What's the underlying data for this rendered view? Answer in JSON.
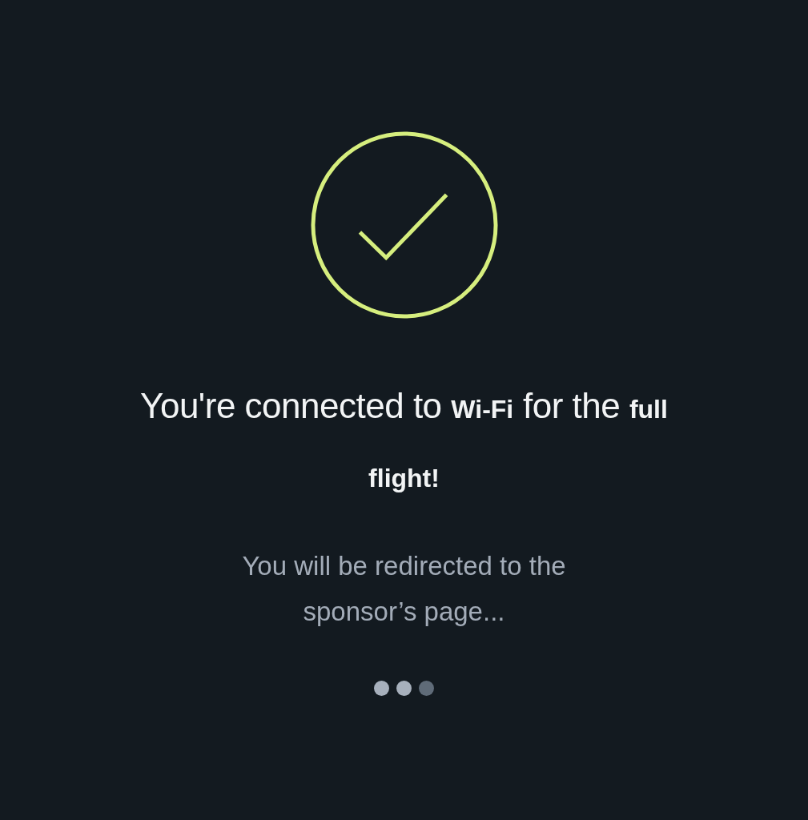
{
  "status_icon": {
    "kind": "check"
  },
  "headline": "You're connected to **Wi-Fi** for the **full flight!**",
  "message": "You will be redirected to the sponsor’s page...",
  "loading_dots": [
    {
      "active": true
    },
    {
      "active": true
    },
    {
      "active": false
    }
  ]
}
